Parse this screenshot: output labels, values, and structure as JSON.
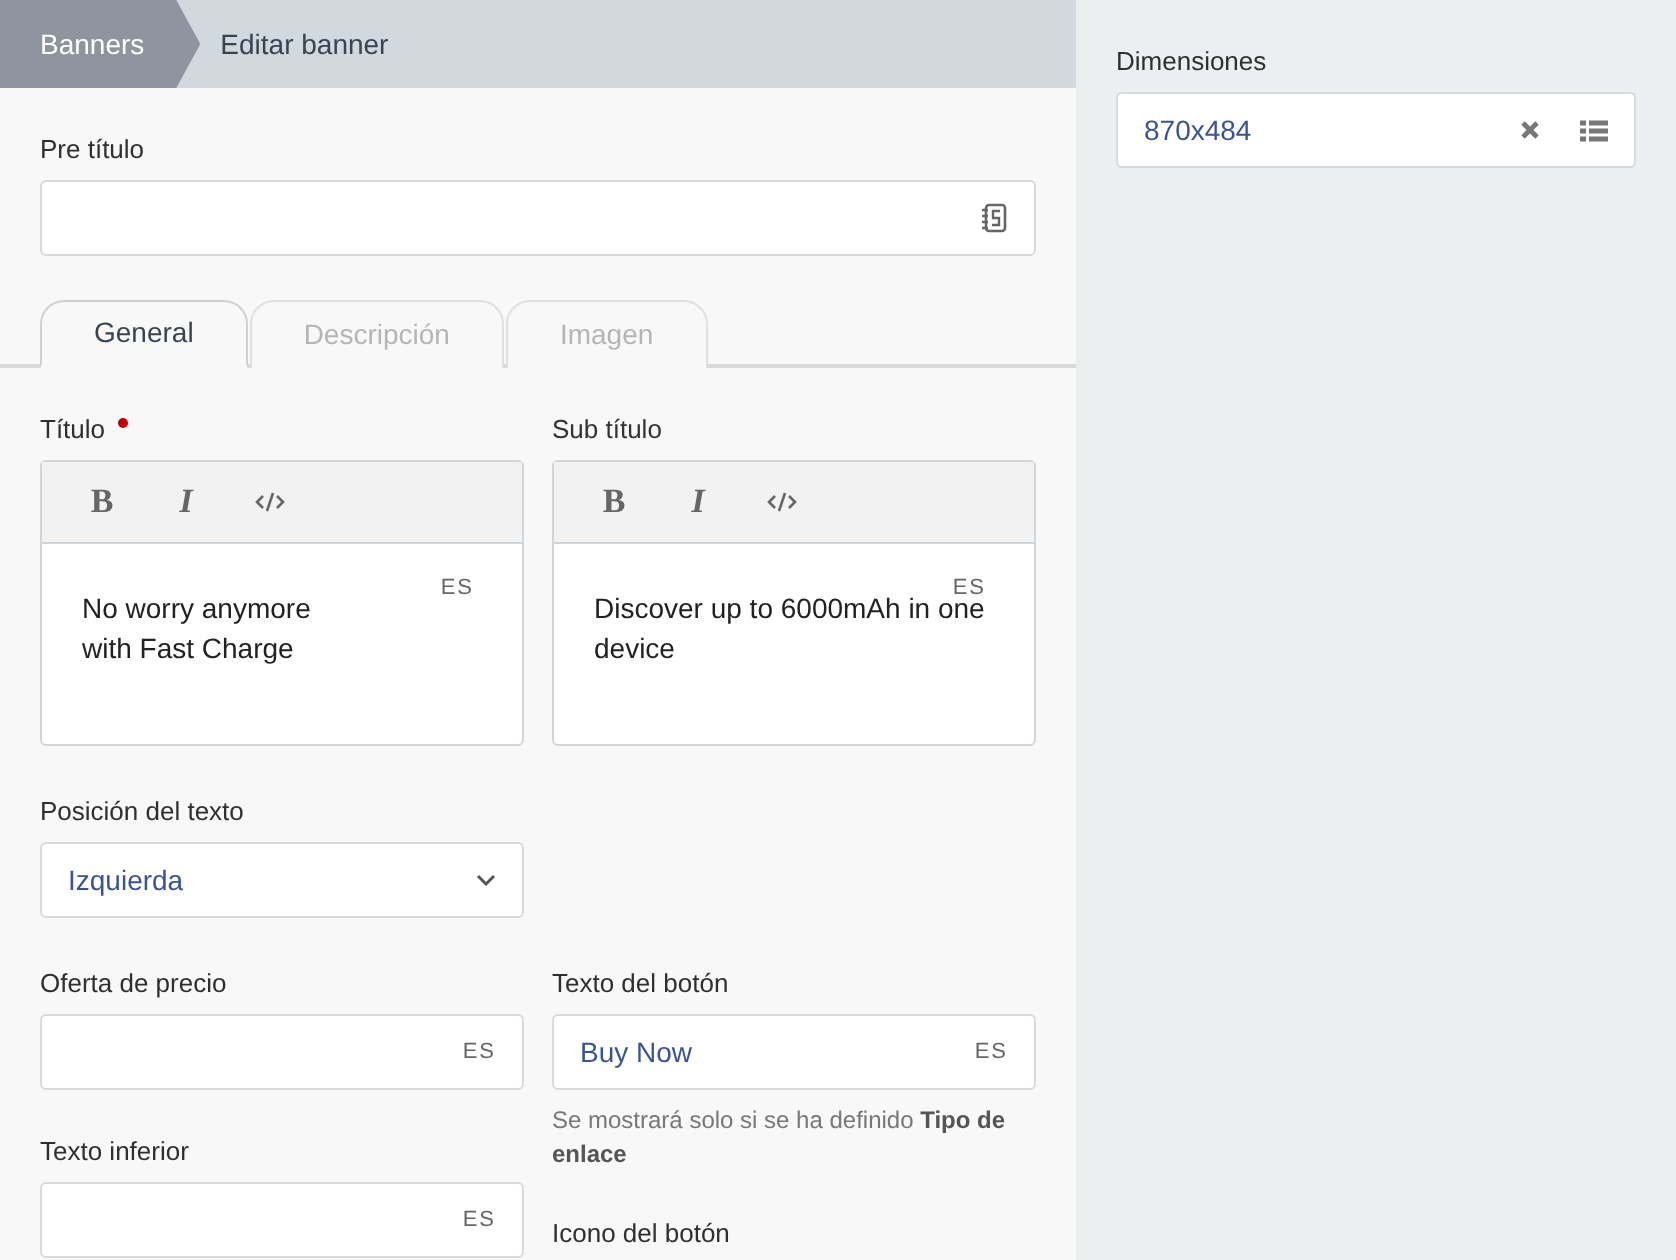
{
  "breadcrumb": [
    {
      "label": "Banners",
      "kind": "root"
    },
    {
      "label": "Editar banner",
      "kind": "current"
    }
  ],
  "pre_title": {
    "label": "Pre título"
  },
  "tabs": [
    {
      "label": "General",
      "selected": true
    },
    {
      "label": "Descripción",
      "selected": false
    },
    {
      "label": "Imagen",
      "selected": false
    }
  ],
  "editors": [
    {
      "label": "Título",
      "required": true,
      "lang": "ES",
      "text": "No worry anymore\nwith Fast Charge",
      "toolbar": [
        {
          "kind": "bold",
          "label": "B"
        },
        {
          "kind": "italic",
          "label": "I"
        },
        {
          "kind": "code"
        }
      ]
    },
    {
      "label": "Sub título",
      "required": false,
      "lang": "ES",
      "text": "Discover up to 6000mAh in one device",
      "toolbar": [
        {
          "kind": "bold",
          "label": "B"
        },
        {
          "kind": "italic",
          "label": "I"
        },
        {
          "kind": "code"
        }
      ]
    }
  ],
  "text_position": {
    "label": "Posición del texto",
    "value": "Izquierda"
  },
  "left_fields": [
    {
      "label": "Oferta de precio",
      "lang": "ES"
    },
    {
      "label": "Texto inferior",
      "lang": "ES"
    }
  ],
  "right_fields": [
    {
      "label": "Texto del botón",
      "value": "Buy Now",
      "lang": "ES",
      "help": "Se mostrará solo si se ha definido **Tipo de enlace**"
    },
    {
      "label": "Icono del botón"
    }
  ],
  "sidebar": {
    "dimensions": {
      "label": "Dimensiones",
      "value": "870x484"
    }
  }
}
